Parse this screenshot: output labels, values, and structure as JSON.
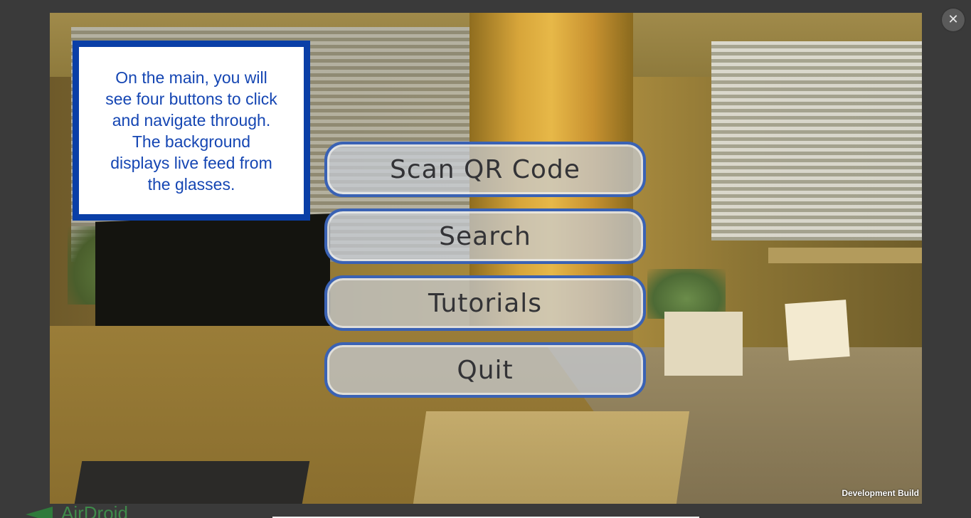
{
  "viewer": {
    "close_label": "✕",
    "callout_text": "On the main, you will\nsee four buttons to click\nand navigate through.\nThe background\ndisplays live feed from\nthe glasses.",
    "menu": [
      {
        "label": "Scan QR Code"
      },
      {
        "label": "Search"
      },
      {
        "label": "Tutorials"
      },
      {
        "label": "Quit"
      }
    ],
    "build_label": "Development Build"
  },
  "background_page": {
    "logo_text": "AirDroid"
  },
  "colors": {
    "overlay_bg": "#3a3a3a",
    "callout_border": "#0a3fa7",
    "callout_text": "#1546b3",
    "button_border": "#3a62b4",
    "button_text": "#333336"
  },
  "icons": {
    "close": "close-icon",
    "logo": "airdroid-logo-icon"
  }
}
